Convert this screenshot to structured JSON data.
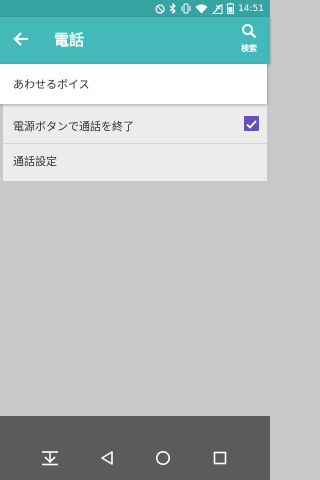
{
  "status_bar": {
    "time": "14:51",
    "icons": [
      "do-not-disturb-icon",
      "bluetooth-icon",
      "vibrate-icon",
      "wifi-icon",
      "signal-no-sim-icon",
      "battery-icon"
    ]
  },
  "app_bar": {
    "title": "電話",
    "search_label": "検索",
    "back_icon": "arrow-left-icon",
    "search_icon": "search-icon"
  },
  "settings": {
    "items": [
      {
        "label": "あわせるボイス"
      },
      {
        "label": "電源ボタンで通話を終了",
        "checkbox_checked": true
      },
      {
        "label": "通話設定"
      }
    ]
  },
  "nav_bar": {
    "icons": [
      "hide-nav-icon",
      "back-triangle-icon",
      "home-circle-icon",
      "recents-square-icon"
    ]
  },
  "colors": {
    "status_bar": "#38a3a3",
    "app_bar": "#44b9b9",
    "checkbox": "#6a4fb4",
    "background": "#c8c8c8",
    "nav_bar": "#5b5b5b"
  }
}
